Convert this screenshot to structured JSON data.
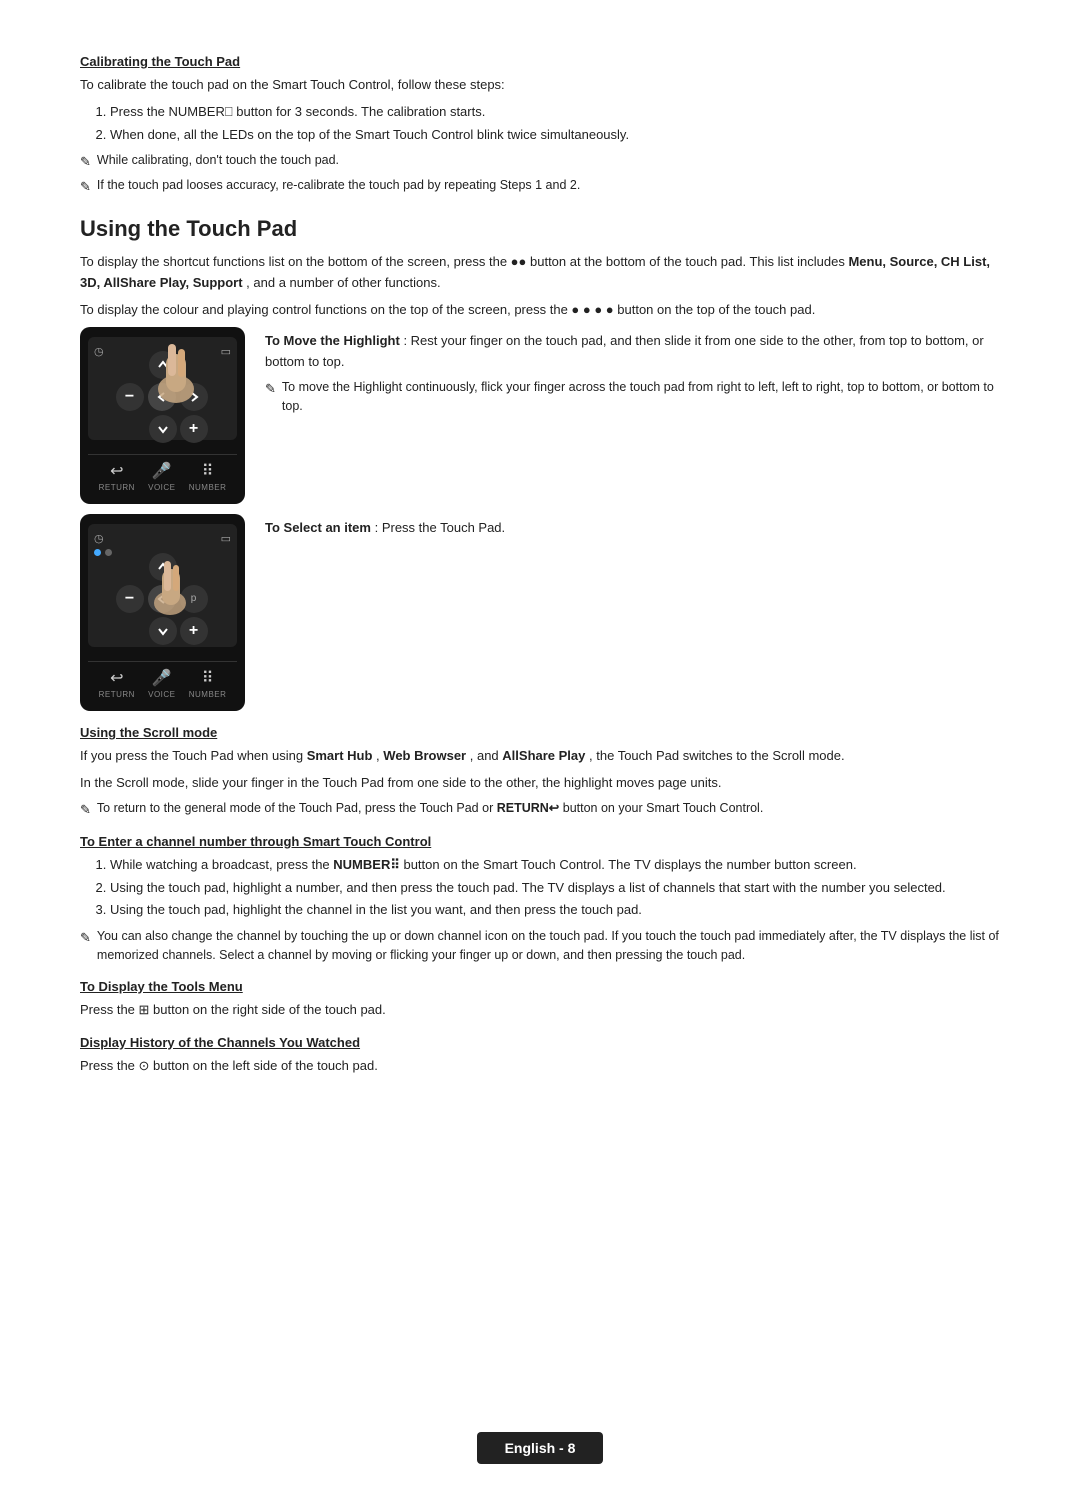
{
  "calibrating": {
    "title": "Calibrating the Touch Pad",
    "intro": "To calibrate the touch pad on the Smart Touch Control, follow these steps:",
    "steps": [
      "Press the NUMBER⎕ button for 3 seconds. The calibration starts.",
      "When done, all the LEDs on the top of the Smart Touch Control blink twice simultaneously."
    ],
    "notes": [
      "While calibrating, don't touch the touch pad.",
      "If the touch pad looses accuracy, re-calibrate the touch pad by repeating Steps 1 and 2."
    ]
  },
  "using_touch_pad": {
    "title": "Using the Touch Pad",
    "intro1": "To display the shortcut functions list on the bottom of the screen, press the ●● button at the bottom of the touch pad. This list includes ",
    "bold_items": "Menu, Source, CH List, 3D, AllShare Play, Support",
    "intro1_end": ", and a number of other functions.",
    "intro2": "To display the colour and playing control functions on the top of the screen, press the ● ● ● ● button on the top of the touch pad.",
    "move_highlight_title": "To Move the Highlight",
    "move_highlight_text": ": Rest your finger on the touch pad, and then slide it from one side to the other, from top to bottom, or bottom to top.",
    "move_note": "To move the Highlight continuously, flick your finger across the touch pad from right to left, left to right, top to bottom, or bottom to top.",
    "select_item_title": "To Select an item",
    "select_item_text": ": Press the Touch Pad."
  },
  "scroll_mode": {
    "title": "Using the Scroll mode",
    "text1": "If you press the Touch Pad when using ",
    "bold1": "Smart Hub",
    "text2": ", ",
    "bold2": "Web Browser",
    "text3": ", and ",
    "bold3": "AllShare Play",
    "text4": ", the Touch Pad switches to the Scroll mode.",
    "text5": "In the Scroll mode, slide your finger in the Touch Pad from one side to the other, the highlight moves page units.",
    "note": "To return to the general mode of the Touch Pad, press the Touch Pad or RETURN↩ button on your Smart Touch Control."
  },
  "channel_number": {
    "title": "To Enter a channel number through Smart Touch Control",
    "steps": [
      "While watching a broadcast, press the NUMBER⎕ button on the Smart Touch Control. The TV displays the number button screen.",
      "Using the touch pad, highlight a number, and then press the touch pad. The TV displays a list of channels that start with the number you selected.",
      "Using the touch pad, highlight the channel in the list you want, and then press the touch pad."
    ],
    "note": "You can also change the channel by touching the up or down channel icon on the touch pad. If you touch the touch pad immediately after, the TV displays the list of memorized channels. Select a channel by moving or flicking your finger up or down, and then pressing the touch pad."
  },
  "tools_menu": {
    "title": "To Display the Tools Menu",
    "text": "Press the ⊞ button on the right side of the touch pad."
  },
  "channel_history": {
    "title": "Display History of the Channels You Watched",
    "text": "Press the ⊙ button on the left side of the touch pad."
  },
  "footer": {
    "label": "English - 8"
  }
}
